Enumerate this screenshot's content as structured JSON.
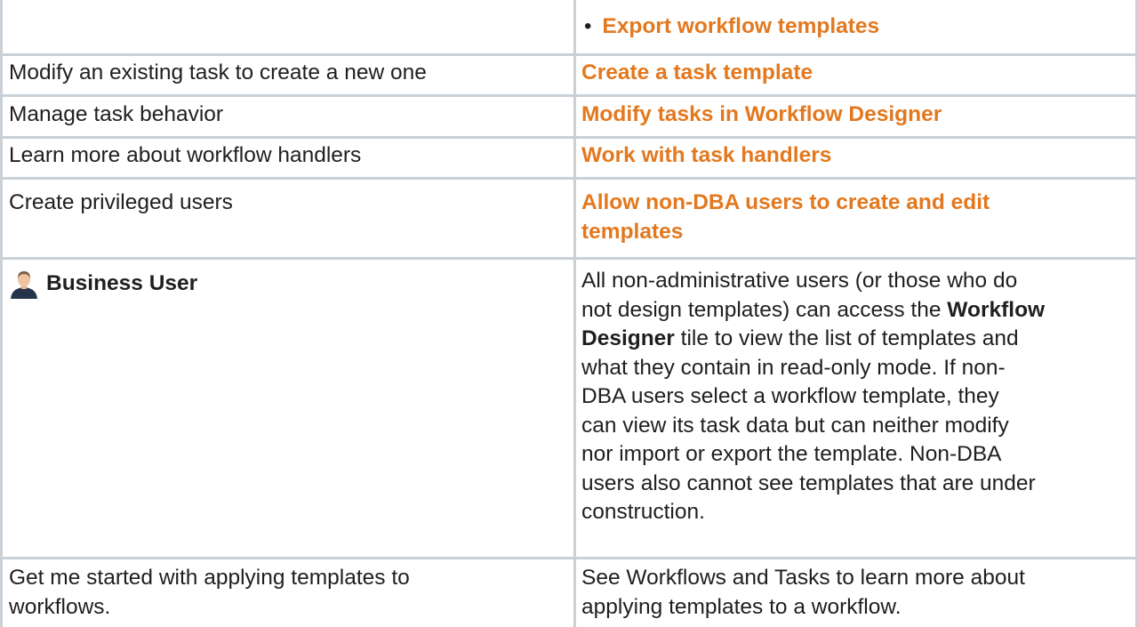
{
  "rows": {
    "export": {
      "bullet": "•",
      "link": "Export workflow templates"
    },
    "modify_task": {
      "goal": "Modify an existing task to create a new one",
      "link": "Create a task template"
    },
    "task_behavior": {
      "goal": "Manage task behavior",
      "link": "Modify tasks in Workflow Designer"
    },
    "handlers": {
      "goal": "Learn more about workflow handlers",
      "link": "Work with task handlers"
    },
    "privileged": {
      "goal": "Create privileged users",
      "link_lines": [
        "Allow non-DBA users to create and edit",
        "templates"
      ]
    },
    "business_user": {
      "icon": "user-avatar-icon",
      "label": "Business User",
      "desc": {
        "line1": "All non-administrative users (or those who do",
        "line2_pre": "not design templates) can access the ",
        "line2_bold": "Workflow",
        "line3_bold": "Designer",
        "line3_post": " tile to view the list of templates and",
        "line4": "what they contain in read-only mode. If non-",
        "line5": "DBA users select a workflow template, they",
        "line6": "can view its task data but can neither modify",
        "line7": "nor import or export the template. Non-DBA",
        "line8": "users also cannot see templates that are under",
        "line9": "construction."
      }
    },
    "get_started": {
      "goal_lines": [
        "Get me started with applying templates to",
        "workflows."
      ],
      "desc_lines": [
        "See Workflows and Tasks to learn more about",
        "applying templates to a workflow."
      ]
    }
  },
  "colors": {
    "link": "#e3781e",
    "grid": "#c9d0d6",
    "text": "#1f1f1f"
  }
}
